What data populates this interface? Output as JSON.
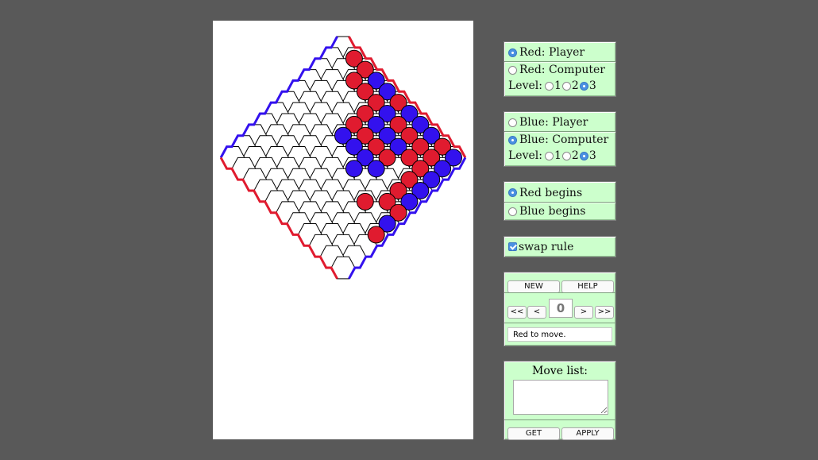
{
  "board": {
    "rows": [
      "",
      "R",
      "R",
      "RB",
      "RB",
      "RR",
      "RBB",
      "RBRB",
      "BRBRB",
      "BRBRR",
      "BRRRB",
      "BB RB",
      "  RB",
      "   RB",
      "    RRRRRRB",
      "     BBBRBBR",
      "      B BB",
      "       R"
    ],
    "red_color": "#e01b2f",
    "blue_color": "#3311ee"
  },
  "red_panel": {
    "player_label": "Red: Player",
    "computer_label": "Red: Computer",
    "level_label": "Level:",
    "levels": [
      "1",
      "2",
      "3"
    ]
  },
  "blue_panel": {
    "player_label": "Blue: Player",
    "computer_label": "Blue: Computer",
    "level_label": "Level:",
    "levels": [
      "1",
      "2",
      "3"
    ]
  },
  "begin_panel": {
    "red_begins": "Red begins",
    "blue_begins": "Blue begins"
  },
  "swap_panel": {
    "swap_label": "swap rule"
  },
  "control_panel": {
    "new_label": "NEW",
    "help_label": "HELP",
    "first_label": "<<",
    "prev_label": "<",
    "move_number": "0",
    "next_label": ">",
    "last_label": ">>",
    "status_text": "Red to move."
  },
  "movelist_panel": {
    "title": "Move list:",
    "get_label": "GET",
    "apply_label": "APPLY"
  }
}
